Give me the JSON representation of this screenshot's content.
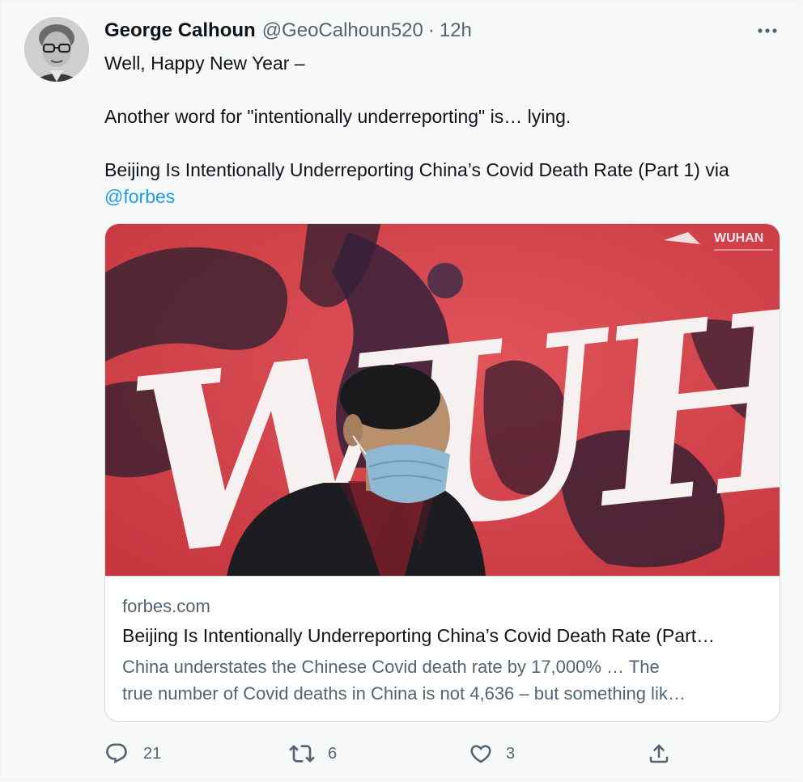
{
  "tweet": {
    "author_name": "George Calhoun",
    "handle": "@GeoCalhoun520",
    "separator": "·",
    "time": "12h",
    "more_icon": "more-horizontal-icon",
    "text": {
      "line1": "Well, Happy New Year –",
      "line2": "Another word for \"intentionally underreporting\" is… lying.",
      "line3": "Beijing Is Intentionally Underreporting China’s Covid Death Rate (Part 1) via",
      "mention": "@forbes"
    }
  },
  "card": {
    "image_text": "WUHAN",
    "image_corner_text": "WUHAN",
    "domain": "forbes.com",
    "title": "Beijing Is Intentionally Underreporting China’s Covid Death Rate (Part…",
    "description_line1": "China understates the Chinese Covid death rate by 17,000% … The",
    "description_line2": "true number of Covid deaths in China is not 4,636 – but something lik…"
  },
  "actions": {
    "reply": {
      "icon": "reply-icon",
      "count": "21"
    },
    "retweet": {
      "icon": "retweet-icon",
      "count": "6"
    },
    "like": {
      "icon": "heart-icon",
      "count": "3"
    },
    "share": {
      "icon": "share-icon"
    }
  },
  "colors": {
    "link": "#1d9bf0",
    "secondary_text": "#536471",
    "poster_red": "#d5404a"
  }
}
